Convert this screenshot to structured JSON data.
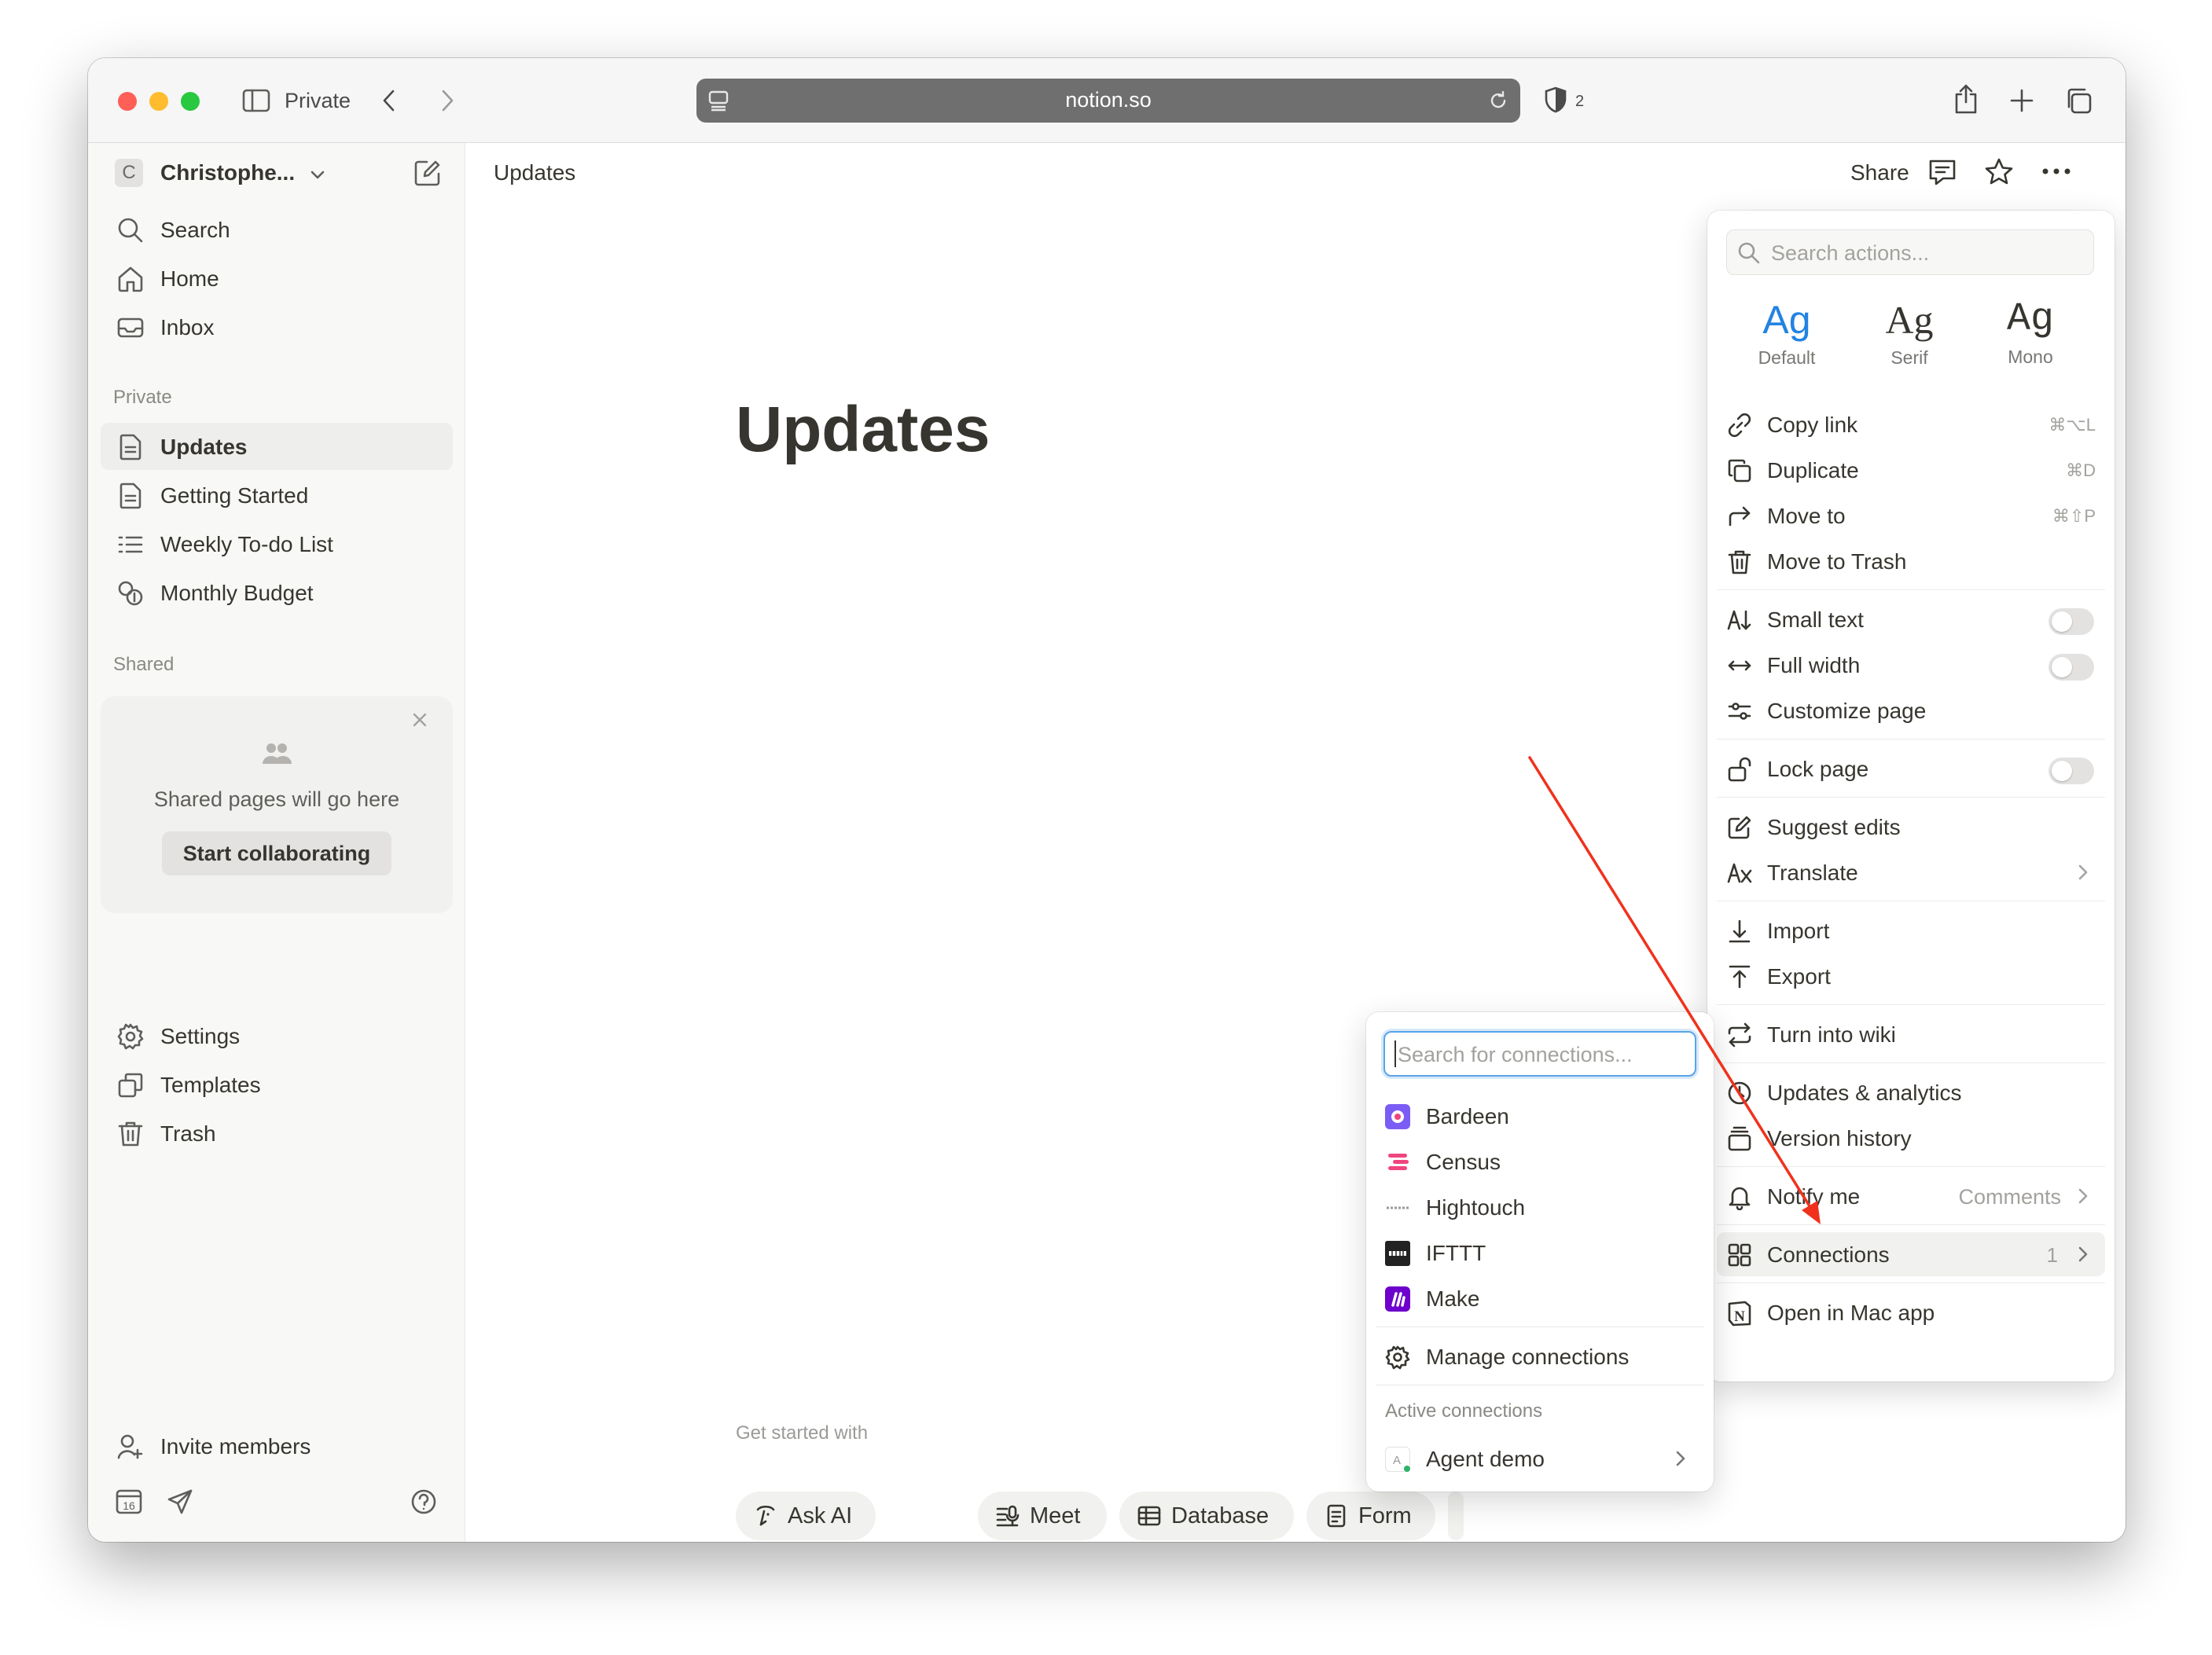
{
  "browser": {
    "profile_label": "Private",
    "url": "notion.so",
    "shield_count": "2"
  },
  "sidebar": {
    "workspace_initial": "C",
    "workspace_name": "Christophe...",
    "nav": [
      {
        "label": "Search",
        "icon": "search-icon"
      },
      {
        "label": "Home",
        "icon": "home-icon"
      },
      {
        "label": "Inbox",
        "icon": "inbox-icon"
      }
    ],
    "private_heading": "Private",
    "private_pages": [
      {
        "label": "Updates",
        "icon": "page-icon",
        "active": true
      },
      {
        "label": "Getting Started",
        "icon": "page-icon"
      },
      {
        "label": "Weekly To-do List",
        "icon": "list-icon"
      },
      {
        "label": "Monthly Budget",
        "icon": "budget-icon"
      }
    ],
    "shared_heading": "Shared",
    "shared_empty_text": "Shared pages will go here",
    "start_collaborating": "Start collaborating",
    "bottom": [
      {
        "label": "Settings",
        "icon": "gear-icon"
      },
      {
        "label": "Templates",
        "icon": "templates-icon"
      },
      {
        "label": "Trash",
        "icon": "trash-icon"
      }
    ],
    "invite_members": "Invite members",
    "calendar_day": "16"
  },
  "topbar": {
    "breadcrumb": "Updates",
    "share": "Share"
  },
  "page": {
    "title": "Updates",
    "get_started_label": "Get started with",
    "chips": [
      "Ask AI",
      "Meet",
      "Database",
      "Form"
    ]
  },
  "actions_menu": {
    "search_placeholder": "Search actions...",
    "fonts": [
      {
        "sample": "Ag",
        "label": "Default",
        "selected": true
      },
      {
        "sample": "Ag",
        "label": "Serif"
      },
      {
        "sample": "Ag",
        "label": "Mono"
      }
    ],
    "copy_link": "Copy link",
    "copy_link_shortcut": "⌘⌥L",
    "duplicate": "Duplicate",
    "duplicate_shortcut": "⌘D",
    "move_to": "Move to",
    "move_to_shortcut": "⌘⇧P",
    "move_to_trash": "Move to Trash",
    "small_text": "Small text",
    "full_width": "Full width",
    "customize_page": "Customize page",
    "lock_page": "Lock page",
    "suggest_edits": "Suggest edits",
    "translate": "Translate",
    "import": "Import",
    "export": "Export",
    "turn_into_wiki": "Turn into wiki",
    "updates_analytics": "Updates & analytics",
    "version_history": "Version history",
    "notify_me": "Notify me",
    "notify_me_value": "Comments",
    "connections": "Connections",
    "connections_count": "1",
    "open_in_mac_app": "Open in Mac app"
  },
  "connections_menu": {
    "search_placeholder": "Search for connections...",
    "items": [
      {
        "label": "Bardeen",
        "color": "#7b5cf5"
      },
      {
        "label": "Census",
        "color": "#f0457f"
      },
      {
        "label": "Hightouch",
        "color": "#9a9a9a"
      },
      {
        "label": "IFTTT",
        "color": "#222222"
      },
      {
        "label": "Make",
        "color": "#6d00cc"
      }
    ],
    "manage": "Manage connections",
    "active_heading": "Active connections",
    "active_items": [
      {
        "label": "Agent demo"
      }
    ]
  },
  "colors": {
    "accent": "#2383e2",
    "annotation_arrow": "#f0321c"
  }
}
